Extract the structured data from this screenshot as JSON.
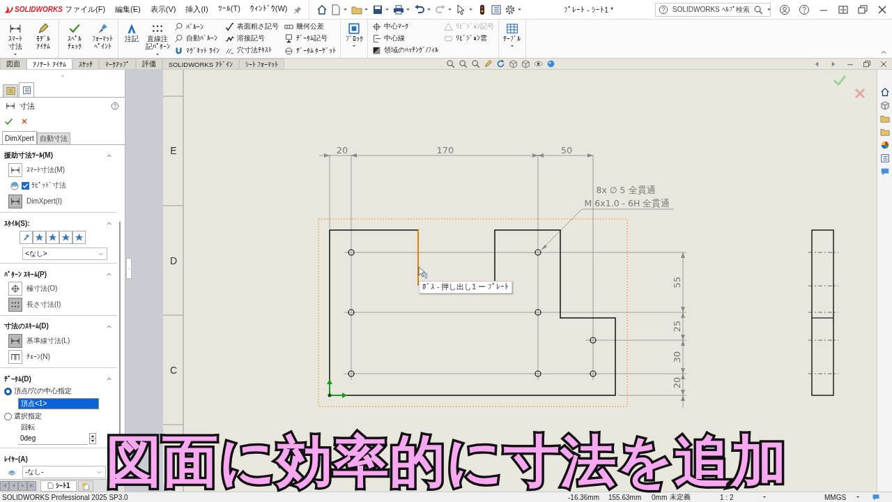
{
  "title_bar": {
    "logo": "SOLIDWORKS",
    "menus": [
      "ファイル(F)",
      "編集(E)",
      "表示(V)",
      "挿入(I)",
      "ﾂｰﾙ(T)",
      "ｳｨﾝﾄﾞｳ(W)"
    ],
    "document_title": "ﾌﾟﾚｰﾄ - ｼｰﾄ1 *",
    "search": {
      "placeholder": "SOLIDWORKS ﾍﾙﾌﾟ検索"
    }
  },
  "ribbon": {
    "groups": [
      {
        "items": [
          {
            "kind": "large",
            "lines": [
              "ｽﾏｰﾄ",
              "寸法"
            ],
            "dropdown": true
          },
          {
            "kind": "large",
            "lines": [
              "ﾓﾃﾞﾙ",
              "ｱｲﾃﾑ"
            ],
            "dropdown": false
          }
        ]
      },
      {
        "items": [
          {
            "kind": "large",
            "lines": [
              "ｽﾍﾟﾙ",
              "ﾁｪｯｸ"
            ],
            "dropdown": false
          },
          {
            "kind": "large",
            "lines": [
              "ﾌｫｰﾏｯﾄ",
              "ﾍﾟｲﾝﾄ"
            ],
            "dropdown": false
          }
        ]
      },
      {
        "items": [
          {
            "kind": "large",
            "lines": [
              "注記"
            ],
            "dropdown": false
          },
          {
            "kind": "large",
            "lines": [
              "直線注",
              "記ﾊﾟﾀｰﾝ"
            ],
            "dropdown": true
          },
          {
            "kind": "column",
            "tools": [
              {
                "label": "ﾊﾞﾙｰﾝ",
                "disabled": false
              },
              {
                "label": "自動ﾊﾞﾙｰﾝ",
                "disabled": false
              },
              {
                "label": "ﾏｸﾞﾈｯﾄ ﾗｲﾝ",
                "disabled": false
              }
            ]
          },
          {
            "kind": "column",
            "tools": [
              {
                "label": "表面粗さ記号",
                "disabled": false
              },
              {
                "label": "溶接記号",
                "disabled": false
              },
              {
                "label": "穴寸法ﾃｷｽﾄ",
                "disabled": false
              }
            ]
          },
          {
            "kind": "column",
            "tools": [
              {
                "label": "幾何公差",
                "disabled": false
              },
              {
                "label": "ﾃﾞｰﾀﾑ記号",
                "disabled": false
              },
              {
                "label": "ﾃﾞｰﾀﾑ ﾀｰｹﾞｯﾄ",
                "disabled": false
              }
            ]
          }
        ]
      },
      {
        "items": [
          {
            "kind": "large",
            "lines": [
              "ﾌﾞﾛｯｸ"
            ],
            "dropdown": true
          }
        ]
      },
      {
        "items": [
          {
            "kind": "column",
            "tools": [
              {
                "label": "中心ﾏｰｸ",
                "disabled": false
              },
              {
                "label": "中心線",
                "disabled": false
              },
              {
                "label": "領域のﾊｯﾁﾝｸﾞ/ﾌｨﾙ",
                "disabled": false
              }
            ]
          },
          {
            "kind": "column",
            "tools": [
              {
                "label": "ﾘﾋﾞｼﾞｮﾝ記号",
                "disabled": true
              },
              {
                "label": "ﾘﾋﾞｼﾞｮﾝ雲",
                "disabled": false
              }
            ]
          }
        ]
      },
      {
        "items": [
          {
            "kind": "large",
            "lines": [
              "ﾃｰﾌﾞﾙ"
            ],
            "dropdown": true
          }
        ]
      }
    ]
  },
  "tabs": [
    {
      "label": "図面",
      "selected": false
    },
    {
      "label": "ｱﾉﾃｰﾄ ｱｲﾃﾑ",
      "selected": true
    },
    {
      "label": "ｽｹｯﾁ",
      "selected": false
    },
    {
      "label": "ﾏｰｸｱｯﾌﾟ",
      "selected": false
    },
    {
      "label": "評価",
      "selected": false
    },
    {
      "label": "SOLIDWORKS ｱﾄﾞｲﾝ",
      "selected": false
    },
    {
      "label": "ｼｰﾄ ﾌｫｰﾏｯﾄ",
      "selected": false
    }
  ],
  "property_manager": {
    "panel_tabs": [
      {
        "selected": false
      },
      {
        "selected": true
      }
    ],
    "title": "寸法",
    "subtabs": [
      {
        "label": "DimXpert",
        "selected": true
      },
      {
        "label": "自動寸法",
        "selected": false
      }
    ],
    "sections": [
      {
        "title": "援助寸法ﾂｰﾙ(M)",
        "expanded": true,
        "items": [
          {
            "kind": "tool",
            "label": "ｽﾏｰﾄ寸法(M)",
            "selected": false
          },
          {
            "kind": "checkbox",
            "label": "ﾗﾋﾟｯﾄﾞ寸法",
            "checked": true
          },
          {
            "kind": "tool",
            "label": "DimXpert(I)",
            "selected": true
          }
        ]
      },
      {
        "title": "ｽﾀｲﾙ(S):",
        "expanded": true,
        "items": [
          {
            "kind": "style_icons"
          },
          {
            "kind": "dropdown",
            "value": "<なし>"
          }
        ]
      },
      {
        "title": "ﾊﾟﾀｰﾝ ｽｷｰﾑ(P)",
        "expanded": true,
        "items": [
          {
            "kind": "tool",
            "label": "極寸法(O)",
            "selected": false
          },
          {
            "kind": "tool",
            "label": "長さ寸法(I)",
            "selected": true
          }
        ]
      },
      {
        "title": "寸法のｽｷｰﾑ(D)",
        "expanded": true,
        "items": [
          {
            "kind": "tool",
            "label": "基準線寸法(L)",
            "selected": true
          },
          {
            "kind": "tool",
            "label": "ﾁｪｰﾝ(N)",
            "selected": false
          }
        ]
      },
      {
        "title": "ﾃﾞｰﾀﾑ(D)",
        "expanded": true,
        "items": [
          {
            "kind": "radio",
            "label": "頂点/穴の中心指定",
            "selected": true
          },
          {
            "kind": "selection_field",
            "value": "頂点<1>"
          },
          {
            "kind": "radio",
            "label": "選択指定",
            "selected": false
          },
          {
            "kind": "label",
            "label": "回転"
          },
          {
            "kind": "spinner",
            "value": "0deg"
          }
        ]
      },
      {
        "title": "ﾚｲﾔｰ(A)",
        "items": [
          {
            "kind": "layer_dropdown",
            "value": "-なし-"
          }
        ]
      }
    ]
  },
  "sheet_tabs": [
    {
      "label": "ｼｰﾄ1",
      "selected": true
    }
  ],
  "drawing": {
    "zones": [
      "E",
      "D",
      "C"
    ],
    "horizontal_dimensions": [
      "20",
      "170",
      "50"
    ],
    "vertical_dimensions": [
      "55",
      "25",
      "30",
      "20"
    ],
    "hole_callout": [
      "8x ∅ 5 全貫通",
      "M 6x1.0 - 6H 全貫通"
    ],
    "tooltip": "ﾎﾞｽ - 押し出し1 ー ﾌﾟﾚｰﾄ"
  },
  "status_bar": {
    "product": "SOLIDWORKS Professional 2025 SP3.0",
    "x": "-16.36mm",
    "y": "155.63mm",
    "z": "0mm",
    "state": "未定義",
    "scale": "1 : 2",
    "units": "MMGS"
  },
  "caption": "図面に効率的に寸法を追加"
}
